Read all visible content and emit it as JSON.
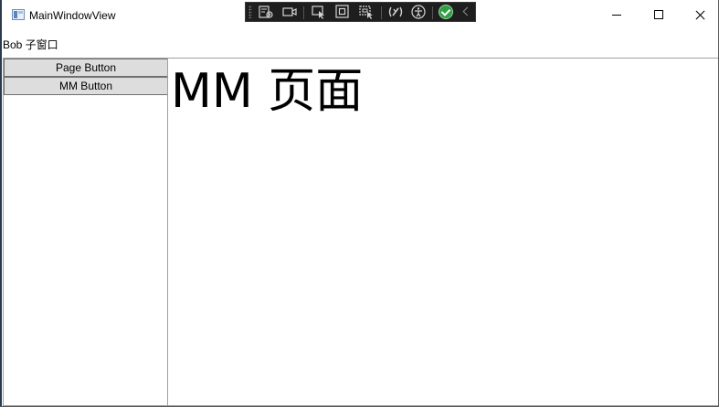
{
  "window": {
    "title": "MainWindowView",
    "label": "Bob 子窗口"
  },
  "devtools": {
    "tools": [
      "live-visual-tree-icon",
      "record-icon",
      "select-element-icon",
      "display-layout-adorners-icon",
      "track-focus-icon",
      "binding-failures-icon",
      "accessibility-icon",
      "check-icon",
      "collapse-icon"
    ]
  },
  "nav": {
    "buttons": [
      "Page Button",
      "MM Button"
    ]
  },
  "content": {
    "heading": "MM 页面"
  },
  "colors": {
    "button_bg": "#dddddd",
    "button_border": "#707070",
    "devbar_bg": "#1e1e1e",
    "check_green": "#2f9e44"
  }
}
